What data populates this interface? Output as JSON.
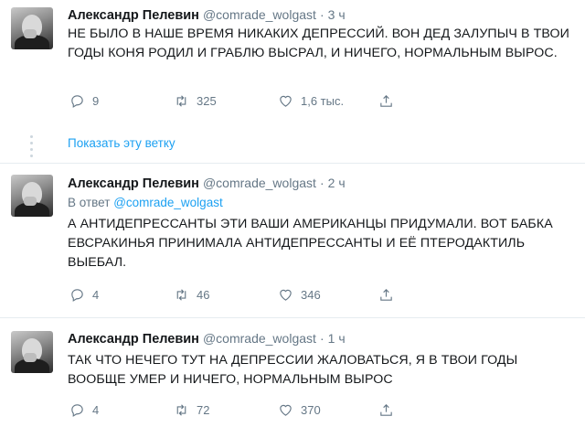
{
  "tweets": [
    {
      "author": "Александр Пелевин",
      "handle": "@comrade_wolgast",
      "time": "3 ч",
      "reply_to": null,
      "text": "НЕ БЫЛО В НАШЕ ВРЕМЯ НИКАКИХ ДЕПРЕССИЙ. ВОН ДЕД ЗАЛУПЫЧ В ТВОИ ГОДЫ КОНЯ РОДИЛ И ГРАБЛЮ ВЫСРАЛ, И НИЧЕГО, НОРМАЛЬНЫМ ВЫРОС.",
      "replies": "9",
      "retweets": "325",
      "likes": "1,6 тыс."
    },
    {
      "author": "Александр Пелевин",
      "handle": "@comrade_wolgast",
      "time": "2 ч",
      "reply_prefix": "В ответ",
      "reply_to": "@comrade_wolgast",
      "text": "А АНТИДЕПРЕССАНТЫ ЭТИ ВАШИ АМЕРИКАНЦЫ ПРИДУМАЛИ. ВОТ БАБКА ЕВСРАКИНЬЯ ПРИНИМАЛА АНТИДЕПРЕССАНТЫ И ЕЁ ПТЕРОДАКТИЛЬ ВЫЕБАЛ.",
      "replies": "4",
      "retweets": "46",
      "likes": "346"
    },
    {
      "author": "Александр Пелевин",
      "handle": "@comrade_wolgast",
      "time": "1 ч",
      "reply_to": null,
      "text": "ТАК ЧТО НЕЧЕГО ТУТ НА ДЕПРЕССИИ ЖАЛОВАТЬСЯ, Я В ТВОИ ГОДЫ ВООБЩЕ УМЕР И НИЧЕГО, НОРМАЛЬНЫМ ВЫРОС",
      "replies": "4",
      "retweets": "72",
      "likes": "370"
    }
  ],
  "show_thread_label": "Показать эту ветку",
  "colors": {
    "link": "#1da1f2",
    "muted": "#657786",
    "text": "#14171a"
  },
  "icons": [
    "reply-icon",
    "retweet-icon",
    "like-icon",
    "share-icon"
  ]
}
